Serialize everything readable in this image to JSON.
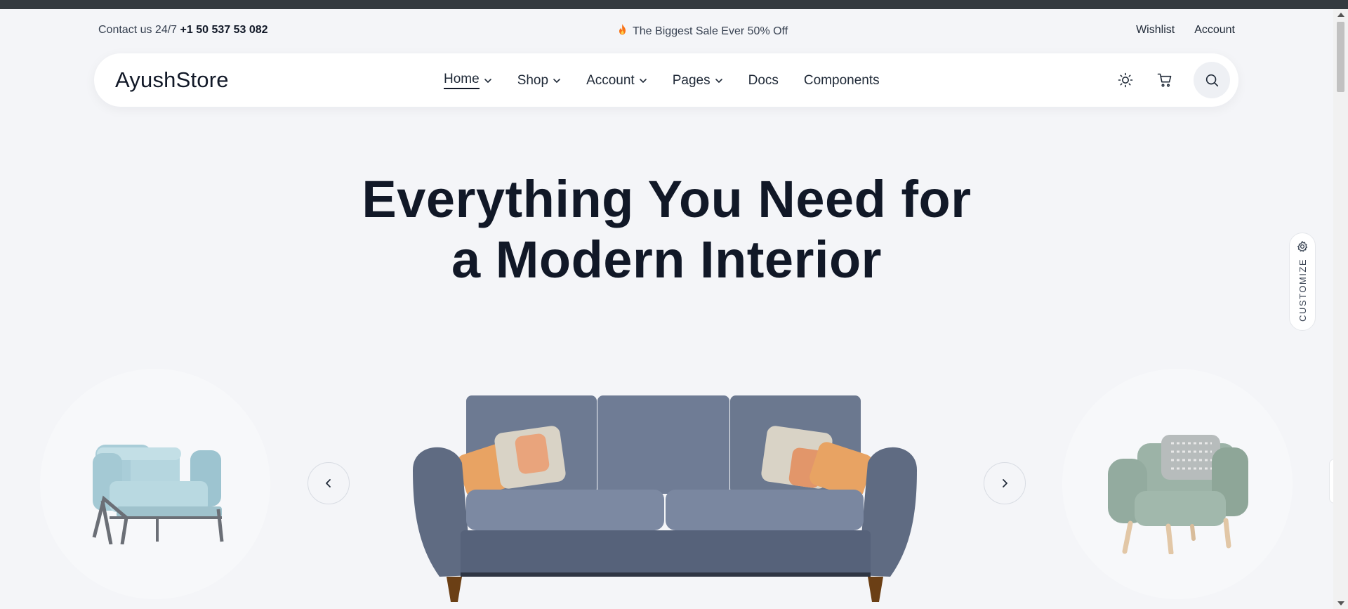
{
  "topbar": {
    "contact_prefix": "Contact us 24/7",
    "contact_phone": "+1 50 537 53 082",
    "promo_text": "The Biggest Sale Ever 50% Off",
    "links": [
      "Wishlist",
      "Account"
    ]
  },
  "nav": {
    "brand": "AyushStore",
    "items": [
      {
        "label": "Home"
      },
      {
        "label": "Shop"
      },
      {
        "label": "Account"
      },
      {
        "label": "Pages"
      },
      {
        "label": "Docs"
      },
      {
        "label": "Components"
      }
    ]
  },
  "hero": {
    "title_line1": "Everything You Need for",
    "title_line2": "a Modern Interior"
  },
  "customize": {
    "label": "CUSTOMIZE"
  },
  "colors": {
    "background": "#f4f5f8",
    "text_dark": "#111827",
    "accent_fire": "#f97316"
  }
}
